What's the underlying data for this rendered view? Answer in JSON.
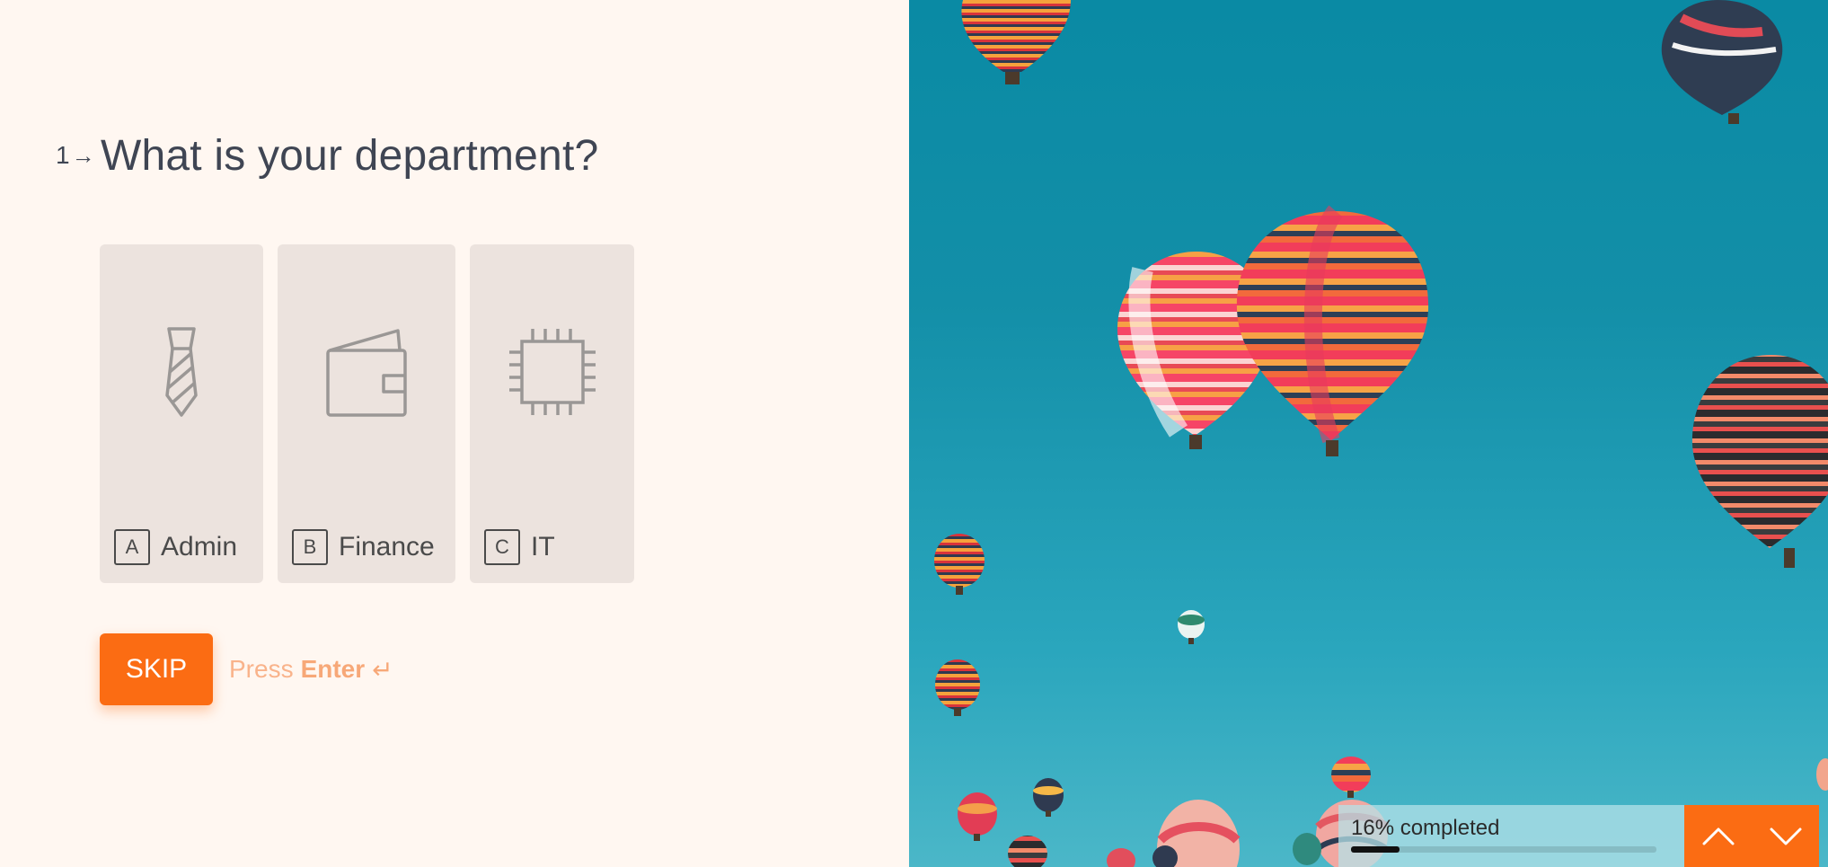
{
  "question": {
    "number": "1",
    "arrow": "→",
    "title": "What is your department?"
  },
  "options": [
    {
      "key": "A",
      "label": "Admin",
      "icon": "tie-icon"
    },
    {
      "key": "B",
      "label": "Finance",
      "icon": "wallet-icon"
    },
    {
      "key": "C",
      "label": "IT",
      "icon": "chip-icon"
    }
  ],
  "actions": {
    "skip_label": "SKIP",
    "hint_prefix": "Press",
    "hint_key": "Enter",
    "hint_icon": "↵"
  },
  "progress": {
    "text": "16% completed",
    "percent": 16
  },
  "colors": {
    "accent": "#fb6c13",
    "background": "#fff7f1",
    "option_bg": "#ece3de",
    "text": "#3f4553"
  }
}
